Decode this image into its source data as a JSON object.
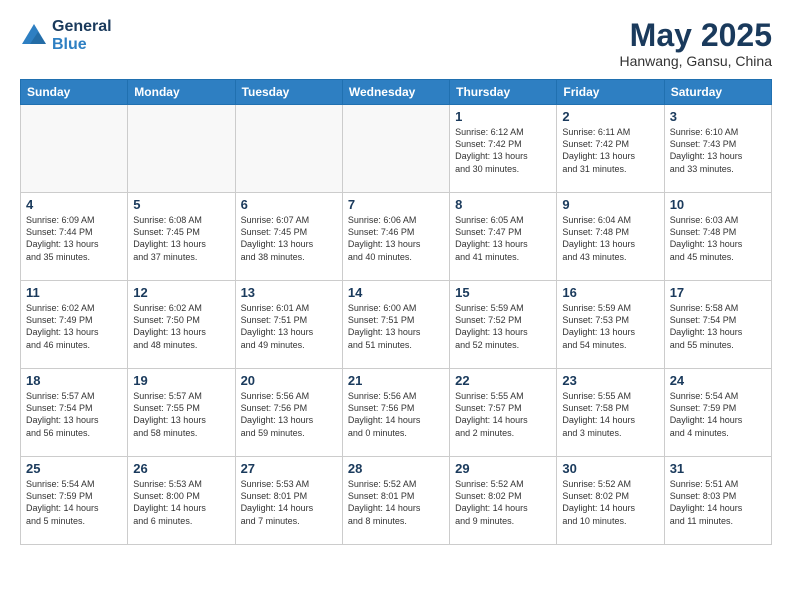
{
  "logo": {
    "line1": "General",
    "line2": "Blue"
  },
  "title": "May 2025",
  "location": "Hanwang, Gansu, China",
  "days_of_week": [
    "Sunday",
    "Monday",
    "Tuesday",
    "Wednesday",
    "Thursday",
    "Friday",
    "Saturday"
  ],
  "weeks": [
    [
      {
        "day": "",
        "info": ""
      },
      {
        "day": "",
        "info": ""
      },
      {
        "day": "",
        "info": ""
      },
      {
        "day": "",
        "info": ""
      },
      {
        "day": "1",
        "info": "Sunrise: 6:12 AM\nSunset: 7:42 PM\nDaylight: 13 hours\nand 30 minutes."
      },
      {
        "day": "2",
        "info": "Sunrise: 6:11 AM\nSunset: 7:42 PM\nDaylight: 13 hours\nand 31 minutes."
      },
      {
        "day": "3",
        "info": "Sunrise: 6:10 AM\nSunset: 7:43 PM\nDaylight: 13 hours\nand 33 minutes."
      }
    ],
    [
      {
        "day": "4",
        "info": "Sunrise: 6:09 AM\nSunset: 7:44 PM\nDaylight: 13 hours\nand 35 minutes."
      },
      {
        "day": "5",
        "info": "Sunrise: 6:08 AM\nSunset: 7:45 PM\nDaylight: 13 hours\nand 37 minutes."
      },
      {
        "day": "6",
        "info": "Sunrise: 6:07 AM\nSunset: 7:45 PM\nDaylight: 13 hours\nand 38 minutes."
      },
      {
        "day": "7",
        "info": "Sunrise: 6:06 AM\nSunset: 7:46 PM\nDaylight: 13 hours\nand 40 minutes."
      },
      {
        "day": "8",
        "info": "Sunrise: 6:05 AM\nSunset: 7:47 PM\nDaylight: 13 hours\nand 41 minutes."
      },
      {
        "day": "9",
        "info": "Sunrise: 6:04 AM\nSunset: 7:48 PM\nDaylight: 13 hours\nand 43 minutes."
      },
      {
        "day": "10",
        "info": "Sunrise: 6:03 AM\nSunset: 7:48 PM\nDaylight: 13 hours\nand 45 minutes."
      }
    ],
    [
      {
        "day": "11",
        "info": "Sunrise: 6:02 AM\nSunset: 7:49 PM\nDaylight: 13 hours\nand 46 minutes."
      },
      {
        "day": "12",
        "info": "Sunrise: 6:02 AM\nSunset: 7:50 PM\nDaylight: 13 hours\nand 48 minutes."
      },
      {
        "day": "13",
        "info": "Sunrise: 6:01 AM\nSunset: 7:51 PM\nDaylight: 13 hours\nand 49 minutes."
      },
      {
        "day": "14",
        "info": "Sunrise: 6:00 AM\nSunset: 7:51 PM\nDaylight: 13 hours\nand 51 minutes."
      },
      {
        "day": "15",
        "info": "Sunrise: 5:59 AM\nSunset: 7:52 PM\nDaylight: 13 hours\nand 52 minutes."
      },
      {
        "day": "16",
        "info": "Sunrise: 5:59 AM\nSunset: 7:53 PM\nDaylight: 13 hours\nand 54 minutes."
      },
      {
        "day": "17",
        "info": "Sunrise: 5:58 AM\nSunset: 7:54 PM\nDaylight: 13 hours\nand 55 minutes."
      }
    ],
    [
      {
        "day": "18",
        "info": "Sunrise: 5:57 AM\nSunset: 7:54 PM\nDaylight: 13 hours\nand 56 minutes."
      },
      {
        "day": "19",
        "info": "Sunrise: 5:57 AM\nSunset: 7:55 PM\nDaylight: 13 hours\nand 58 minutes."
      },
      {
        "day": "20",
        "info": "Sunrise: 5:56 AM\nSunset: 7:56 PM\nDaylight: 13 hours\nand 59 minutes."
      },
      {
        "day": "21",
        "info": "Sunrise: 5:56 AM\nSunset: 7:56 PM\nDaylight: 14 hours\nand 0 minutes."
      },
      {
        "day": "22",
        "info": "Sunrise: 5:55 AM\nSunset: 7:57 PM\nDaylight: 14 hours\nand 2 minutes."
      },
      {
        "day": "23",
        "info": "Sunrise: 5:55 AM\nSunset: 7:58 PM\nDaylight: 14 hours\nand 3 minutes."
      },
      {
        "day": "24",
        "info": "Sunrise: 5:54 AM\nSunset: 7:59 PM\nDaylight: 14 hours\nand 4 minutes."
      }
    ],
    [
      {
        "day": "25",
        "info": "Sunrise: 5:54 AM\nSunset: 7:59 PM\nDaylight: 14 hours\nand 5 minutes."
      },
      {
        "day": "26",
        "info": "Sunrise: 5:53 AM\nSunset: 8:00 PM\nDaylight: 14 hours\nand 6 minutes."
      },
      {
        "day": "27",
        "info": "Sunrise: 5:53 AM\nSunset: 8:01 PM\nDaylight: 14 hours\nand 7 minutes."
      },
      {
        "day": "28",
        "info": "Sunrise: 5:52 AM\nSunset: 8:01 PM\nDaylight: 14 hours\nand 8 minutes."
      },
      {
        "day": "29",
        "info": "Sunrise: 5:52 AM\nSunset: 8:02 PM\nDaylight: 14 hours\nand 9 minutes."
      },
      {
        "day": "30",
        "info": "Sunrise: 5:52 AM\nSunset: 8:02 PM\nDaylight: 14 hours\nand 10 minutes."
      },
      {
        "day": "31",
        "info": "Sunrise: 5:51 AM\nSunset: 8:03 PM\nDaylight: 14 hours\nand 11 minutes."
      }
    ]
  ]
}
